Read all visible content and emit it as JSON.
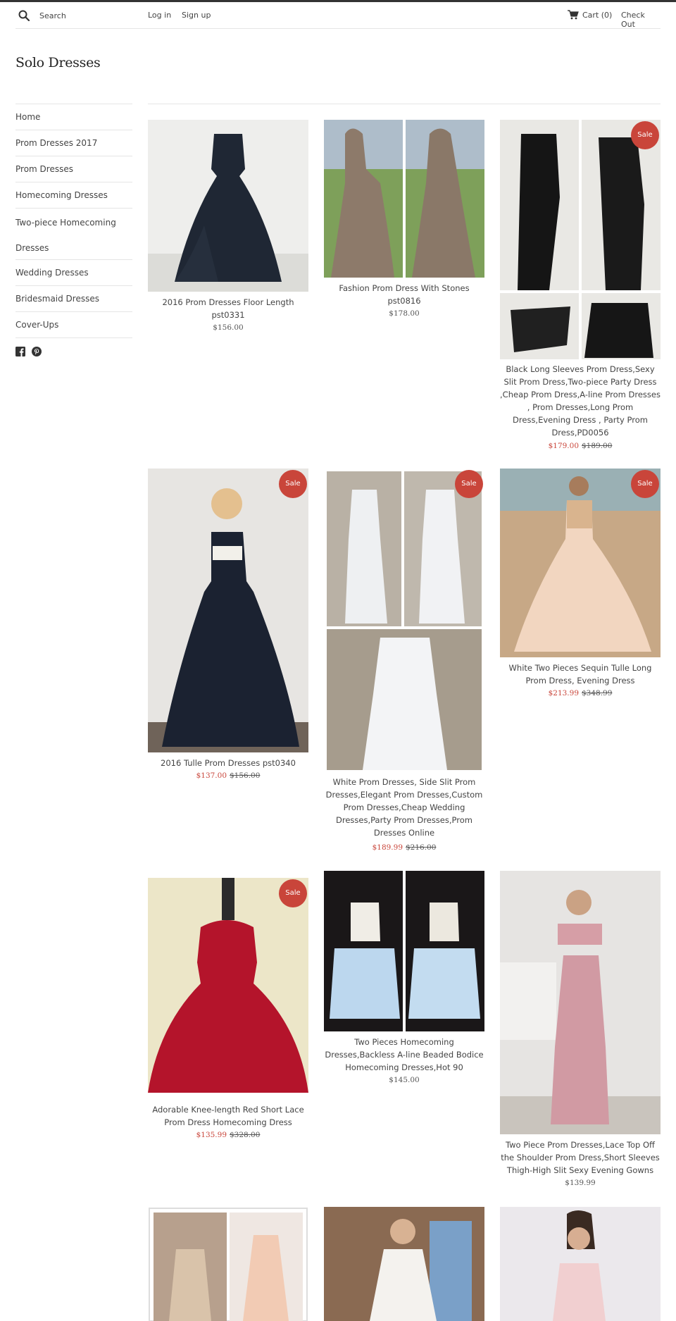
{
  "header": {
    "search_placeholder": "Search",
    "login": "Log in",
    "signup": "Sign up",
    "cart": "Cart (0)",
    "checkout": "Check Out"
  },
  "site_title": "Solo Dresses",
  "sidebar": {
    "items": [
      {
        "label": "Home"
      },
      {
        "label": "Prom Dresses 2017"
      },
      {
        "label": "Prom Dresses"
      },
      {
        "label": "Homecoming Dresses"
      },
      {
        "label": "Two-piece Homecoming\nDresses"
      },
      {
        "label": "Wedding Dresses"
      },
      {
        "label": "Bridesmaid Dresses"
      },
      {
        "label": "Cover-Ups"
      }
    ],
    "social": [
      "facebook-icon",
      "pinterest-icon"
    ]
  },
  "sale_label": "Sale",
  "products": [
    {
      "title": "2016 Prom Dresses Floor Length pst0331",
      "price": "$156.00",
      "old_price": "",
      "on_sale": false
    },
    {
      "title": "Fashion Prom Dress With Stones pst0816",
      "price": "$178.00",
      "old_price": "",
      "on_sale": false
    },
    {
      "title": "Black Long Sleeves Prom Dress,Sexy Slit Prom Dress,Two-piece Party Dress ,Cheap Prom Dress,A-line Prom Dresses , Prom Dresses,Long Prom Dress,Evening Dress , Party Prom Dress,PD0056",
      "price": "$179.00",
      "old_price": "$189.00",
      "on_sale": true
    },
    {
      "title": "2016 Tulle Prom Dresses pst0340",
      "price": "$137.00",
      "old_price": "$156.00",
      "on_sale": true
    },
    {
      "title": "White Prom Dresses, Side Slit Prom Dresses,Elegant Prom Dresses,Custom Prom Dresses,Cheap Wedding Dresses,Party Prom Dresses,Prom Dresses Online",
      "price": "$189.99",
      "old_price": "$216.00",
      "on_sale": true
    },
    {
      "title": "White Two Pieces Sequin Tulle Long Prom Dress, Evening Dress",
      "price": "$213.99",
      "old_price": "$348.99",
      "on_sale": true
    },
    {
      "title": "Adorable Knee-length Red Short Lace Prom Dress Homecoming Dress",
      "price": "$135.99",
      "old_price": "$328.00",
      "on_sale": true
    },
    {
      "title": "Two Pieces Homecoming Dresses,Backless A-line Beaded Bodice Homecoming Dresses,Hot 90",
      "price": "$145.00",
      "old_price": "",
      "on_sale": false
    },
    {
      "title": "Two Piece Prom Dresses,Lace Top Off the Shoulder Prom Dress,Short Sleeves Thigh-High Slit Sexy Evening Gowns",
      "price": "$139.99",
      "old_price": "",
      "on_sale": false
    },
    {
      "title": "",
      "price": "",
      "old_price": "",
      "on_sale": false
    },
    {
      "title": "",
      "price": "",
      "old_price": "",
      "on_sale": false
    },
    {
      "title": "",
      "price": "",
      "old_price": "",
      "on_sale": false
    }
  ],
  "colors": {
    "sale": "#c9453a",
    "text": "#444444",
    "rule": "#e5e5e5"
  }
}
